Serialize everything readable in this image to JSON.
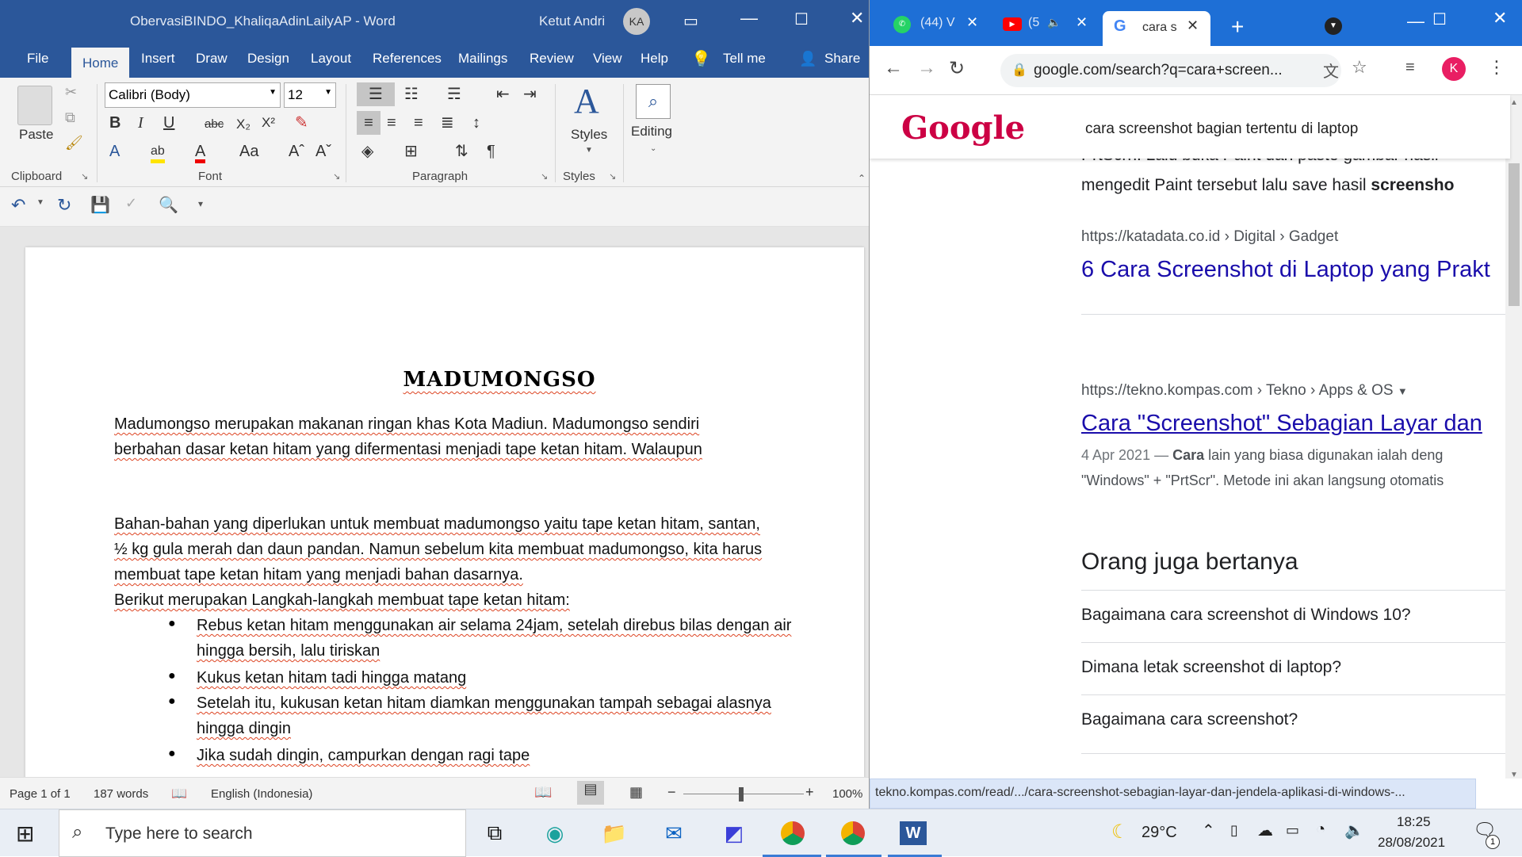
{
  "word": {
    "title": "ObervasiBINDO_KhaliqaAdinLailyAP  -  Word",
    "user": "Ketut Andri",
    "user_initials": "KA",
    "tabs": [
      "File",
      "Home",
      "Insert",
      "Draw",
      "Design",
      "Layout",
      "References",
      "Mailings",
      "Review",
      "View",
      "Help"
    ],
    "tell_me": "Tell me",
    "share": "Share",
    "font_name": "Calibri (Body)",
    "font_size": "12",
    "groups": {
      "clipboard": "Clipboard",
      "font": "Font",
      "paragraph": "Paragraph",
      "styles": "Styles"
    },
    "paste": "Paste",
    "styles_btn": "Styles",
    "editing_btn": "Editing",
    "doc": {
      "title": "MADUMONGSO",
      "p1_l1": "Madumongso merupakan makanan ringan khas Kota Madiun. Madumongso sendiri",
      "p1_l2": "berbahan dasar ketan hitam yang difermentasi menjadi tape ketan hitam. Walaupun",
      "p2_l1": "Bahan-bahan yang diperlukan untuk membuat madumongso yaitu tape ketan hitam, santan,",
      "p2_l2": "½ kg gula merah dan daun pandan. Namun sebelum kita membuat madumongso, kita harus",
      "p2_l3": "membuat tape ketan hitam yang menjadi bahan dasarnya.",
      "p3": "Berikut merupakan Langkah-langkah membuat tape ketan hitam:",
      "b1_l1": "Rebus ketan hitam menggunakan air selama 24jam, setelah direbus bilas dengan air",
      "b1_l2": "hingga bersih, lalu tiriskan",
      "b2": "Kukus ketan hitam tadi hingga matang",
      "b3_l1": "Setelah itu, kukusan ketan hitam diamkan menggunakan tampah sebagai alasnya",
      "b3_l2": "hingga dingin",
      "b4": " Jika sudah dingin, campurkan dengan ragi tape"
    },
    "status": {
      "page": "Page 1 of 1",
      "words": "187 words",
      "language": "English (Indonesia)",
      "zoom": "100%"
    }
  },
  "chrome": {
    "tabs": [
      {
        "label": "(44) V",
        "icon": "whatsapp-icon"
      },
      {
        "label": "(5",
        "icon": "youtube-icon"
      },
      {
        "label": "cara s",
        "icon": "google-icon"
      }
    ],
    "url": "google.com/search?q=cara+screen...",
    "profile_initial": "K",
    "search_query": "cara screenshot bagian tertentu di laptop",
    "logo_text": "Google",
    "results": {
      "snippet_top1": "PrtScrn. Lalu buka Paint dan paste gambar hasil",
      "snippet_top2_a": "mengedit Paint tersebut lalu save hasil ",
      "snippet_top2_b": "screensho",
      "r1_url": "https://katadata.co.id › Digital › Gadget",
      "r1_title": "6 Cara Screenshot di Laptop yang Prakt",
      "r2_url": "https://tekno.kompas.com › Tekno › Apps & OS",
      "r2_title": "Cara \"Screenshot\" Sebagian Layar dan",
      "r2_date": "4 Apr 2021 — ",
      "r2_bold": "Cara",
      "r2_snip1": " lain yang biasa digunakan ialah deng",
      "r2_snip2": "\"Windows\" + \"PrtScr\". Metode ini akan langsung otomatis",
      "paa_title": "Orang juga bertanya",
      "paa": [
        "Bagaimana cara screenshot di Windows 10?",
        "Dimana letak screenshot di laptop?",
        "Bagaimana cara screenshot?"
      ]
    },
    "status_url": "tekno.kompas.com/read/.../cara-screenshot-sebagian-layar-dan-jendela-aplikasi-di-windows-..."
  },
  "taskbar": {
    "search_placeholder": "Type here to search",
    "temperature": "29°C",
    "time": "18:25",
    "date": "28/08/2021",
    "notif_count": "1"
  },
  "colors": {
    "word_blue": "#2b579a",
    "chrome_blue": "#1e6fd6",
    "link_blue": "#1a0dab"
  }
}
